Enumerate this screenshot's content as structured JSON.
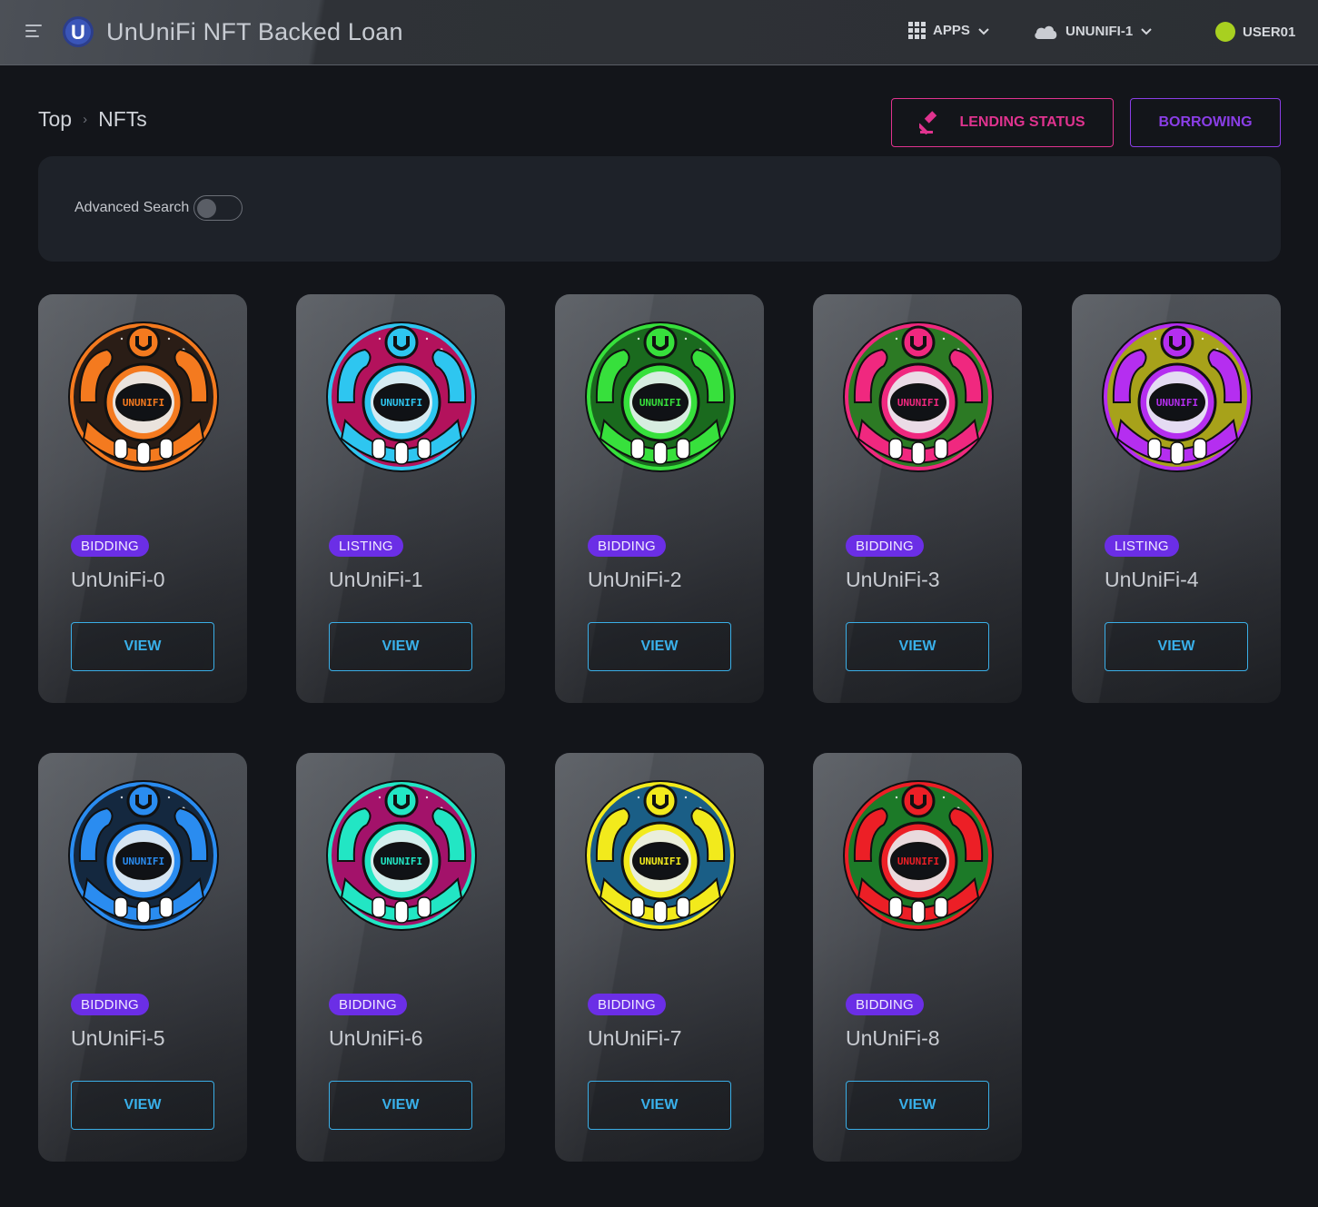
{
  "header": {
    "title": "UnUniFi NFT Backed Loan",
    "logo_letter": "U",
    "apps_label": "APPS",
    "network_label": "UNUNIFI-1",
    "user_label": "USER01"
  },
  "breadcrumb": {
    "items": [
      "Top",
      "NFTs"
    ],
    "separator": "›"
  },
  "actions": {
    "lending_status": "LENDING STATUS",
    "borrowing": "BORROWING"
  },
  "search": {
    "advanced_label": "Advanced Search",
    "advanced_enabled": false
  },
  "nfts": [
    {
      "name": "UnUniFi-0",
      "status": "BIDDING",
      "view": "VIEW",
      "main_color": "#f47a1f",
      "accent_color": "#2a1d16",
      "visor_text": "UNUNIFI"
    },
    {
      "name": "UnUniFi-1",
      "status": "LISTING",
      "view": "VIEW",
      "main_color": "#2ec6f0",
      "accent_color": "#b3125c",
      "visor_text": "UNUNIFI"
    },
    {
      "name": "UnUniFi-2",
      "status": "BIDDING",
      "view": "VIEW",
      "main_color": "#37e03c",
      "accent_color": "#1a6a1e",
      "visor_text": "UNUNIFI"
    },
    {
      "name": "UnUniFi-3",
      "status": "BIDDING",
      "view": "VIEW",
      "main_color": "#f0287f",
      "accent_color": "#2c7a24",
      "visor_text": "UNUNIFI"
    },
    {
      "name": "UnUniFi-4",
      "status": "LISTING",
      "view": "VIEW",
      "main_color": "#b52ef0",
      "accent_color": "#a7a21a",
      "visor_text": "UNUNIFI"
    },
    {
      "name": "UnUniFi-5",
      "status": "BIDDING",
      "view": "VIEW",
      "main_color": "#2a8cf0",
      "accent_color": "#14283f",
      "visor_text": "UNUNIFI"
    },
    {
      "name": "UnUniFi-6",
      "status": "BIDDING",
      "view": "VIEW",
      "main_color": "#22e6c4",
      "accent_color": "#a3126a",
      "visor_text": "UNUNIFI"
    },
    {
      "name": "UnUniFi-7",
      "status": "BIDDING",
      "view": "VIEW",
      "main_color": "#f2ea1c",
      "accent_color": "#1a5e86",
      "visor_text": "UNUNIFI"
    },
    {
      "name": "UnUniFi-8",
      "status": "BIDDING",
      "view": "VIEW",
      "main_color": "#ec1f26",
      "accent_color": "#1c7a28",
      "visor_text": "UNUNIFI"
    }
  ],
  "colors": {
    "badge_bg": "#6b2ee6",
    "view_border": "#3aaee6",
    "lending_accent": "#e0338f",
    "borrowing_accent": "#8a3ee6",
    "user_status": "#a8d020"
  }
}
